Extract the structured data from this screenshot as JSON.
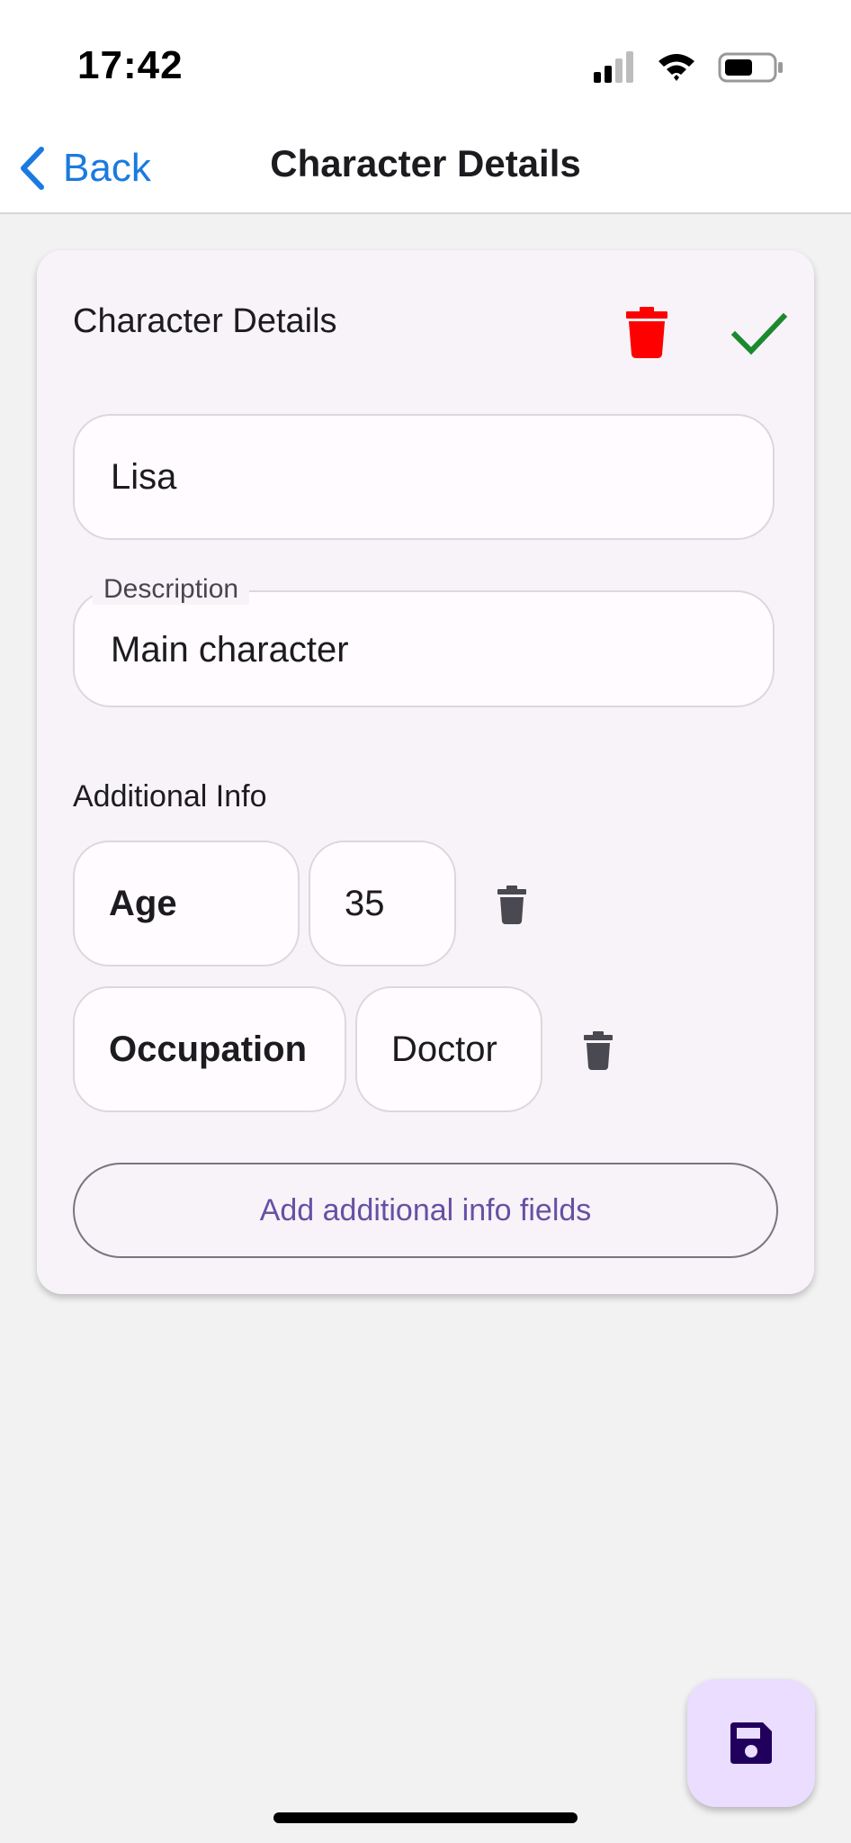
{
  "status_bar": {
    "time": "17:42",
    "icons": [
      "signal-icon",
      "wifi-icon",
      "battery-icon"
    ]
  },
  "nav": {
    "back_label": "Back",
    "title": "Character Details"
  },
  "card": {
    "title": "Character Details",
    "name_value": "Lisa",
    "description_label": "Description",
    "description_value": "Main character",
    "additional_info_label": "Additional Info",
    "additional_info": [
      {
        "key": "Age",
        "value": "35"
      },
      {
        "key": "Occupation",
        "value": "Doctor"
      }
    ],
    "add_fields_label": "Add additional info fields"
  },
  "colors": {
    "accent": "#6750a4",
    "link_blue": "#1a7ae0",
    "delete_red": "#ff0000",
    "confirm_green": "#1b8a2e",
    "fab_bg": "#eaddff"
  }
}
